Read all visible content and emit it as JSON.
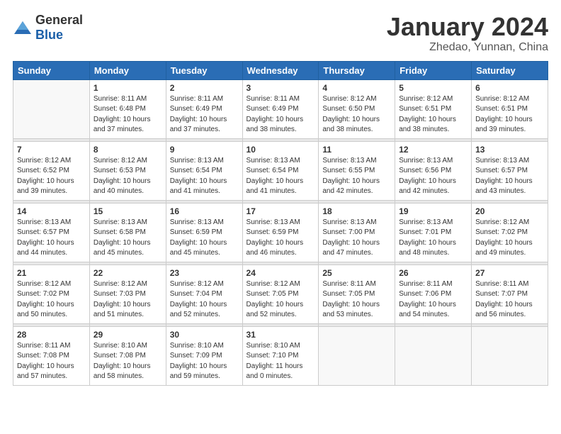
{
  "logo": {
    "general": "General",
    "blue": "Blue"
  },
  "header": {
    "title": "January 2024",
    "subtitle": "Zhedao, Yunnan, China"
  },
  "weekdays": [
    "Sunday",
    "Monday",
    "Tuesday",
    "Wednesday",
    "Thursday",
    "Friday",
    "Saturday"
  ],
  "weeks": [
    [
      {
        "day": "",
        "info": ""
      },
      {
        "day": "1",
        "info": "Sunrise: 8:11 AM\nSunset: 6:48 PM\nDaylight: 10 hours\nand 37 minutes."
      },
      {
        "day": "2",
        "info": "Sunrise: 8:11 AM\nSunset: 6:49 PM\nDaylight: 10 hours\nand 37 minutes."
      },
      {
        "day": "3",
        "info": "Sunrise: 8:11 AM\nSunset: 6:49 PM\nDaylight: 10 hours\nand 38 minutes."
      },
      {
        "day": "4",
        "info": "Sunrise: 8:12 AM\nSunset: 6:50 PM\nDaylight: 10 hours\nand 38 minutes."
      },
      {
        "day": "5",
        "info": "Sunrise: 8:12 AM\nSunset: 6:51 PM\nDaylight: 10 hours\nand 38 minutes."
      },
      {
        "day": "6",
        "info": "Sunrise: 8:12 AM\nSunset: 6:51 PM\nDaylight: 10 hours\nand 39 minutes."
      }
    ],
    [
      {
        "day": "7",
        "info": "Sunrise: 8:12 AM\nSunset: 6:52 PM\nDaylight: 10 hours\nand 39 minutes."
      },
      {
        "day": "8",
        "info": "Sunrise: 8:12 AM\nSunset: 6:53 PM\nDaylight: 10 hours\nand 40 minutes."
      },
      {
        "day": "9",
        "info": "Sunrise: 8:13 AM\nSunset: 6:54 PM\nDaylight: 10 hours\nand 41 minutes."
      },
      {
        "day": "10",
        "info": "Sunrise: 8:13 AM\nSunset: 6:54 PM\nDaylight: 10 hours\nand 41 minutes."
      },
      {
        "day": "11",
        "info": "Sunrise: 8:13 AM\nSunset: 6:55 PM\nDaylight: 10 hours\nand 42 minutes."
      },
      {
        "day": "12",
        "info": "Sunrise: 8:13 AM\nSunset: 6:56 PM\nDaylight: 10 hours\nand 42 minutes."
      },
      {
        "day": "13",
        "info": "Sunrise: 8:13 AM\nSunset: 6:57 PM\nDaylight: 10 hours\nand 43 minutes."
      }
    ],
    [
      {
        "day": "14",
        "info": "Sunrise: 8:13 AM\nSunset: 6:57 PM\nDaylight: 10 hours\nand 44 minutes."
      },
      {
        "day": "15",
        "info": "Sunrise: 8:13 AM\nSunset: 6:58 PM\nDaylight: 10 hours\nand 45 minutes."
      },
      {
        "day": "16",
        "info": "Sunrise: 8:13 AM\nSunset: 6:59 PM\nDaylight: 10 hours\nand 45 minutes."
      },
      {
        "day": "17",
        "info": "Sunrise: 8:13 AM\nSunset: 6:59 PM\nDaylight: 10 hours\nand 46 minutes."
      },
      {
        "day": "18",
        "info": "Sunrise: 8:13 AM\nSunset: 7:00 PM\nDaylight: 10 hours\nand 47 minutes."
      },
      {
        "day": "19",
        "info": "Sunrise: 8:13 AM\nSunset: 7:01 PM\nDaylight: 10 hours\nand 48 minutes."
      },
      {
        "day": "20",
        "info": "Sunrise: 8:12 AM\nSunset: 7:02 PM\nDaylight: 10 hours\nand 49 minutes."
      }
    ],
    [
      {
        "day": "21",
        "info": "Sunrise: 8:12 AM\nSunset: 7:02 PM\nDaylight: 10 hours\nand 50 minutes."
      },
      {
        "day": "22",
        "info": "Sunrise: 8:12 AM\nSunset: 7:03 PM\nDaylight: 10 hours\nand 51 minutes."
      },
      {
        "day": "23",
        "info": "Sunrise: 8:12 AM\nSunset: 7:04 PM\nDaylight: 10 hours\nand 52 minutes."
      },
      {
        "day": "24",
        "info": "Sunrise: 8:12 AM\nSunset: 7:05 PM\nDaylight: 10 hours\nand 52 minutes."
      },
      {
        "day": "25",
        "info": "Sunrise: 8:11 AM\nSunset: 7:05 PM\nDaylight: 10 hours\nand 53 minutes."
      },
      {
        "day": "26",
        "info": "Sunrise: 8:11 AM\nSunset: 7:06 PM\nDaylight: 10 hours\nand 54 minutes."
      },
      {
        "day": "27",
        "info": "Sunrise: 8:11 AM\nSunset: 7:07 PM\nDaylight: 10 hours\nand 56 minutes."
      }
    ],
    [
      {
        "day": "28",
        "info": "Sunrise: 8:11 AM\nSunset: 7:08 PM\nDaylight: 10 hours\nand 57 minutes."
      },
      {
        "day": "29",
        "info": "Sunrise: 8:10 AM\nSunset: 7:08 PM\nDaylight: 10 hours\nand 58 minutes."
      },
      {
        "day": "30",
        "info": "Sunrise: 8:10 AM\nSunset: 7:09 PM\nDaylight: 10 hours\nand 59 minutes."
      },
      {
        "day": "31",
        "info": "Sunrise: 8:10 AM\nSunset: 7:10 PM\nDaylight: 11 hours\nand 0 minutes."
      },
      {
        "day": "",
        "info": ""
      },
      {
        "day": "",
        "info": ""
      },
      {
        "day": "",
        "info": ""
      }
    ]
  ]
}
